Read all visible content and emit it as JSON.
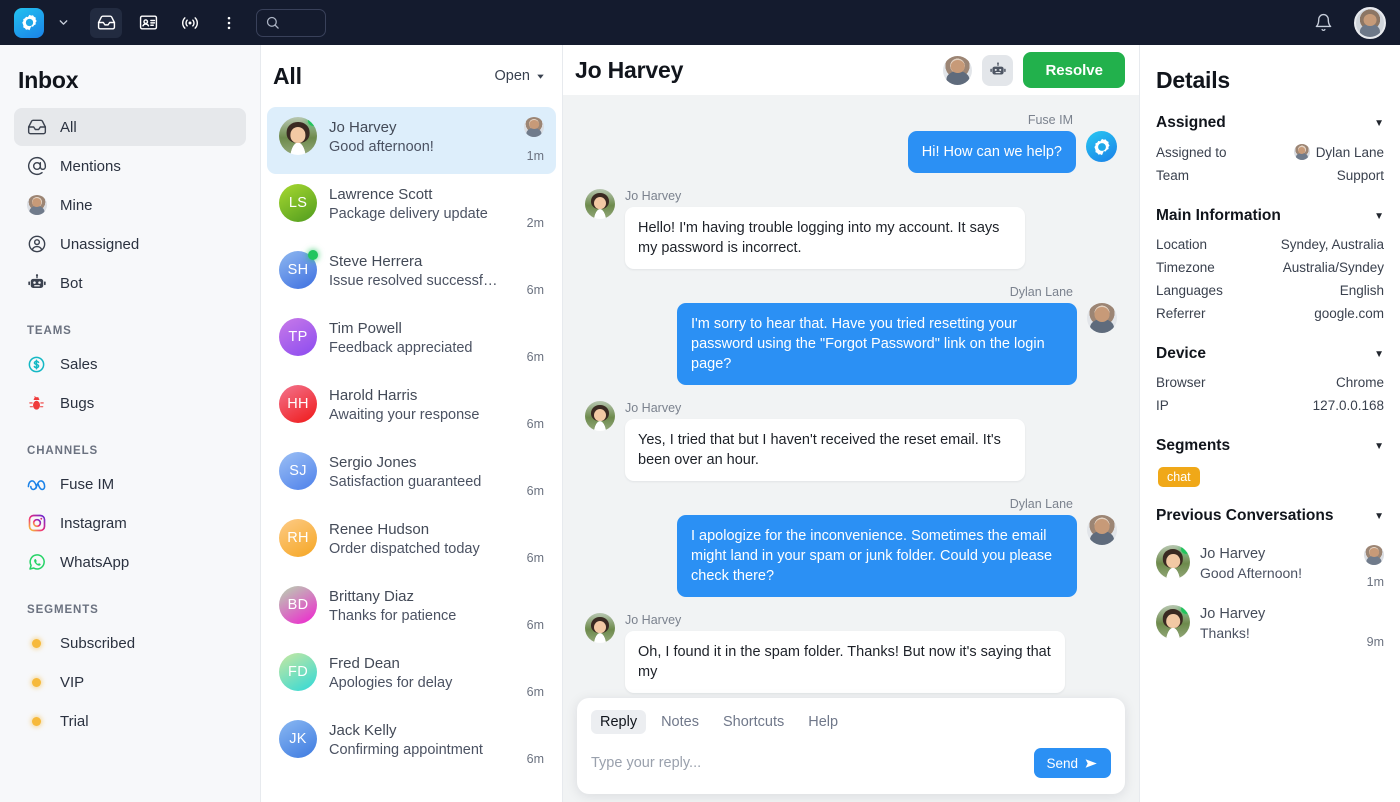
{
  "topbar": {
    "logo_icon": "fuse-logo-icon",
    "dropdown_icon": "chevron-down-icon",
    "icons": [
      {
        "name": "inbox-icon",
        "active": true
      },
      {
        "name": "contact-card-icon",
        "active": false
      },
      {
        "name": "broadcast-icon",
        "active": false
      }
    ],
    "more_icon": "kebab-menu-icon",
    "search_icon": "search-icon",
    "search_value": "",
    "search_placeholder": "",
    "bell_icon": "bell-icon",
    "avatar_icon": "user-avatar"
  },
  "sidebar": {
    "title": "Inbox",
    "items": [
      {
        "label": "All",
        "icon": "inbox-icon",
        "selected": true
      },
      {
        "label": "Mentions",
        "icon": "at-sign-icon",
        "selected": false
      },
      {
        "label": "Mine",
        "icon": "user-photo-icon",
        "selected": false
      },
      {
        "label": "Unassigned",
        "icon": "user-circle-icon",
        "selected": false
      },
      {
        "label": "Bot",
        "icon": "robot-icon",
        "selected": false
      }
    ],
    "teams_label": "TEAMS",
    "teams": [
      {
        "label": "Sales",
        "icon": "dollar-circle-icon",
        "color": "#14b8c4"
      },
      {
        "label": "Bugs",
        "icon": "bug-icon",
        "color": "#ef3b3b"
      }
    ],
    "channels_label": "CHANNELS",
    "channels": [
      {
        "label": "Fuse IM",
        "icon": "fuse-im-icon",
        "color": "#1a82e8"
      },
      {
        "label": "Instagram",
        "icon": "instagram-icon",
        "color": "#e1306c"
      },
      {
        "label": "WhatsApp",
        "icon": "whatsapp-icon",
        "color": "#25d366"
      }
    ],
    "segments_label": "SEGMENTS",
    "segments": [
      {
        "label": "Subscribed",
        "icon": "dot-icon",
        "color": "#f6b93b"
      },
      {
        "label": "VIP",
        "icon": "dot-icon",
        "color": "#f6b93b"
      },
      {
        "label": "Trial",
        "icon": "dot-icon",
        "color": "#f6b93b"
      }
    ]
  },
  "list": {
    "title": "All",
    "filter_label": "Open",
    "filter_icon": "chevron-down-icon",
    "conversations": [
      {
        "name": "Jo Harvey",
        "preview": "Good afternoon!",
        "time": "1m",
        "initials": "",
        "avatar_type": "photo",
        "online": true,
        "active": true,
        "assignee_avatar": true,
        "grad_from": "#9fd45a",
        "grad_to": "#5fa026"
      },
      {
        "name": "Lawrence Scott",
        "preview": "Package delivery update",
        "time": "2m",
        "initials": "LS",
        "avatar_type": "initials",
        "online": false,
        "active": false,
        "assignee_avatar": false,
        "grad_from": "#a8d930",
        "grad_to": "#4f9b1f"
      },
      {
        "name": "Steve Herrera",
        "preview": "Issue resolved successfully",
        "time": "6m",
        "initials": "SH",
        "avatar_type": "initials",
        "online": true,
        "active": false,
        "assignee_avatar": false,
        "grad_from": "#8fb8f0",
        "grad_to": "#3d6fe0"
      },
      {
        "name": "Tim Powell",
        "preview": "Feedback appreciated",
        "time": "6m",
        "initials": "TP",
        "avatar_type": "initials",
        "online": false,
        "active": false,
        "assignee_avatar": false,
        "grad_from": "#c87ae8",
        "grad_to": "#8b4bf0"
      },
      {
        "name": "Harold Harris",
        "preview": "Awaiting your response",
        "time": "6m",
        "initials": "HH",
        "avatar_type": "initials",
        "online": false,
        "active": false,
        "assignee_avatar": false,
        "grad_from": "#f2748e",
        "grad_to": "#f01818"
      },
      {
        "name": "Sergio Jones",
        "preview": "Satisfaction guaranteed",
        "time": "6m",
        "initials": "SJ",
        "avatar_type": "initials",
        "online": false,
        "active": false,
        "assignee_avatar": false,
        "grad_from": "#9cc0f5",
        "grad_to": "#4d80ea"
      },
      {
        "name": "Renee Hudson",
        "preview": "Order dispatched today",
        "time": "6m",
        "initials": "RH",
        "avatar_type": "initials",
        "online": false,
        "active": false,
        "assignee_avatar": false,
        "grad_from": "#fdcb86",
        "grad_to": "#f5a623"
      },
      {
        "name": "Brittany Diaz",
        "preview": "Thanks for patience",
        "time": "6m",
        "initials": "BD",
        "avatar_type": "initials",
        "online": false,
        "active": false,
        "assignee_avatar": false,
        "grad_from": "#b7d7b0",
        "grad_to": "#f020d0"
      },
      {
        "name": "Fred Dean",
        "preview": "Apologies for delay",
        "time": "6m",
        "initials": "FD",
        "avatar_type": "initials",
        "online": false,
        "active": false,
        "assignee_avatar": false,
        "grad_from": "#c9e8a0",
        "grad_to": "#2fd8d8"
      },
      {
        "name": "Jack Kelly",
        "preview": "Confirming appointment",
        "time": "6m",
        "initials": "JK",
        "avatar_type": "initials",
        "online": false,
        "active": false,
        "assignee_avatar": false,
        "grad_from": "#8ab8f2",
        "grad_to": "#3d7ae0"
      }
    ]
  },
  "chat": {
    "title": "Jo Harvey",
    "assignee_avatar_name": "assignee-avatar",
    "bot_icon": "robot-icon",
    "resolve_label": "Resolve",
    "messages": [
      {
        "direction": "out",
        "author": "Fuse IM",
        "text": "Hi! How can we help?",
        "avatar": "fuse-logo"
      },
      {
        "direction": "in",
        "author": "Jo Harvey",
        "text": "Hello! I'm having trouble logging into my account. It says my password is incorrect.",
        "avatar": "customer-photo"
      },
      {
        "direction": "out",
        "author": "Dylan Lane",
        "text": "I'm sorry to hear that. Have you tried resetting your password using the \"Forgot Password\" link on the login page?",
        "avatar": "agent-photo"
      },
      {
        "direction": "in",
        "author": "Jo Harvey",
        "text": "Yes, I tried that but I haven't received the reset email. It's been over an hour.",
        "avatar": "customer-photo"
      },
      {
        "direction": "out",
        "author": "Dylan Lane",
        "text": "I apologize for the inconvenience. Sometimes the email might land in your spam or junk folder. Could you please check there?",
        "avatar": "agent-photo"
      },
      {
        "direction": "in",
        "author": "Jo Harvey",
        "text": "Oh, I found it in the spam folder. Thanks! But now it's saying that my",
        "avatar": "customer-photo"
      }
    ],
    "composer": {
      "tabs": [
        {
          "label": "Reply",
          "active": true
        },
        {
          "label": "Notes",
          "active": false
        },
        {
          "label": "Shortcuts",
          "active": false
        },
        {
          "label": "Help",
          "active": false
        }
      ],
      "input_value": "",
      "input_placeholder": "Type your reply...",
      "send_label": "Send",
      "send_icon": "paper-plane-icon"
    }
  },
  "details": {
    "title": "Details",
    "sections": [
      {
        "heading": "Assigned",
        "caret_icon": "caret-down-icon",
        "rows": [
          {
            "key": "Assigned to",
            "value": "Dylan Lane",
            "has_avatar": true
          },
          {
            "key": "Team",
            "value": "Support",
            "has_avatar": false
          }
        ]
      },
      {
        "heading": "Main Information",
        "caret_icon": "caret-down-icon",
        "rows": [
          {
            "key": "Location",
            "value": "Syndey, Australia",
            "has_avatar": false
          },
          {
            "key": "Timezone",
            "value": "Australia/Syndey",
            "has_avatar": false
          },
          {
            "key": "Languages",
            "value": "English",
            "has_avatar": false
          },
          {
            "key": "Referrer",
            "value": "google.com",
            "has_avatar": false
          }
        ]
      },
      {
        "heading": "Device",
        "caret_icon": "caret-down-icon",
        "rows": [
          {
            "key": "Browser",
            "value": "Chrome",
            "has_avatar": false
          },
          {
            "key": "IP",
            "value": "127.0.0.168",
            "has_avatar": false
          }
        ]
      }
    ],
    "segments_heading": "Segments",
    "segments_chips": [
      {
        "label": "chat",
        "color": "#f0a818"
      }
    ],
    "previous_heading": "Previous Conversations",
    "previous": [
      {
        "name": "Jo Harvey",
        "preview": "Good Afternoon!",
        "time": "1m",
        "online": true,
        "assignee_avatar": true
      },
      {
        "name": "Jo Harvey",
        "preview": "Thanks!",
        "time": "9m",
        "online": true,
        "assignee_avatar": false
      }
    ]
  }
}
